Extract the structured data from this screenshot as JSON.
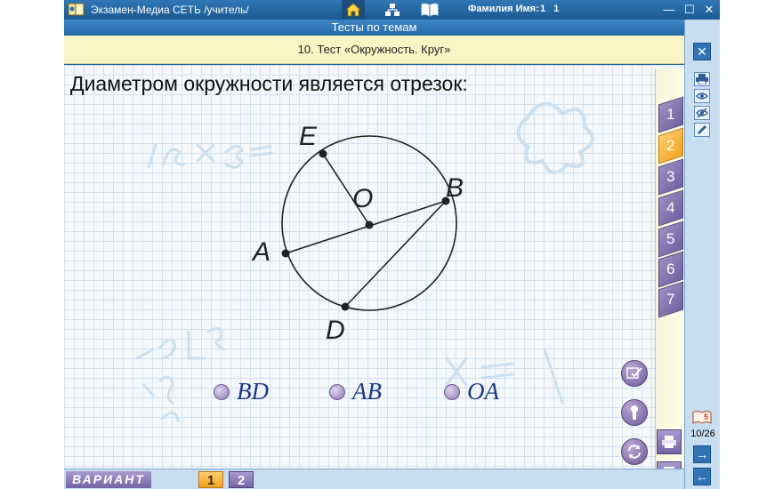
{
  "window": {
    "app_title": "Экзамен-Медиа СЕТЬ /учитель/",
    "user_label": "Фамилия Имя:",
    "user_value": "1 1",
    "controls": [
      "—",
      "☐",
      "✕"
    ]
  },
  "nav": {
    "icons": [
      "home-icon",
      "structure-icon",
      "book-icon"
    ]
  },
  "section_title": "Тесты по темам",
  "test_title": "10. Тест «Окружность. Круг»",
  "question": {
    "text": "Диаметром окружности является отрезок:",
    "figure_labels": {
      "E": "E",
      "O": "O",
      "B": "B",
      "A": "A",
      "D": "D"
    }
  },
  "answers": [
    {
      "label": "BD"
    },
    {
      "label": "AB"
    },
    {
      "label": "OA"
    }
  ],
  "question_tabs": [
    "1",
    "2",
    "3",
    "4",
    "5",
    "6",
    "7"
  ],
  "active_tab": "2",
  "progress": {
    "text": "10/26",
    "current": 10,
    "total": 26
  },
  "variant": {
    "label": "ВАРИАНТ",
    "options": [
      "1",
      "2"
    ],
    "active": "1"
  },
  "right_panel": {
    "close": "✕",
    "next": "→",
    "prev": "←"
  },
  "colors": {
    "title_bar": "#1f5e99",
    "test_title_bg": "#fbf4c4",
    "tab_active": "#f3a020",
    "tab_normal": "#7463a4",
    "answer_text": "#1a3a8c"
  }
}
